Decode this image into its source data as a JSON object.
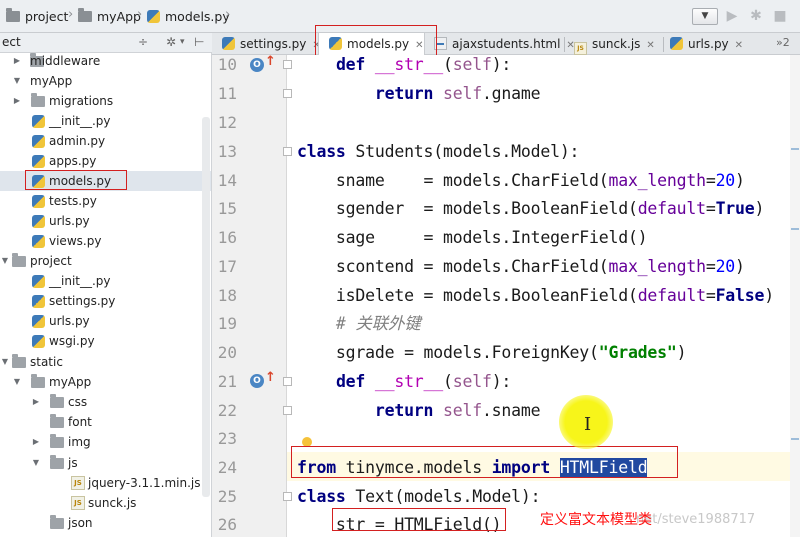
{
  "breadcrumb": [
    "project",
    "myApp",
    "models.py"
  ],
  "project_panel": {
    "title": "ect",
    "tree": [
      {
        "label": "middleware",
        "kind": "folder",
        "expanded": false,
        "selected": false
      },
      {
        "label": "myApp",
        "kind": "folder",
        "expanded": true,
        "selected": false
      },
      {
        "label": "migrations",
        "kind": "folder",
        "expanded": false,
        "selected": false
      },
      {
        "label": "__init__.py",
        "kind": "py",
        "expanded": false,
        "selected": false
      },
      {
        "label": "admin.py",
        "kind": "py",
        "expanded": false,
        "selected": false
      },
      {
        "label": "apps.py",
        "kind": "py",
        "expanded": false,
        "selected": false
      },
      {
        "label": "models.py",
        "kind": "py",
        "expanded": false,
        "selected": true
      },
      {
        "label": "tests.py",
        "kind": "py",
        "expanded": false,
        "selected": false
      },
      {
        "label": "urls.py",
        "kind": "py",
        "expanded": false,
        "selected": false
      },
      {
        "label": "views.py",
        "kind": "py",
        "expanded": false,
        "selected": false
      },
      {
        "label": "project",
        "kind": "folder",
        "expanded": true,
        "selected": false
      },
      {
        "label": "__init__.py",
        "kind": "py",
        "expanded": false,
        "selected": false
      },
      {
        "label": "settings.py",
        "kind": "py",
        "expanded": false,
        "selected": false
      },
      {
        "label": "urls.py",
        "kind": "py",
        "expanded": false,
        "selected": false
      },
      {
        "label": "wsgi.py",
        "kind": "py",
        "expanded": false,
        "selected": false
      },
      {
        "label": "static",
        "kind": "folder",
        "expanded": true,
        "selected": false
      },
      {
        "label": "myApp",
        "kind": "folder",
        "expanded": true,
        "selected": false
      },
      {
        "label": "css",
        "kind": "folder",
        "expanded": false,
        "selected": false
      },
      {
        "label": "font",
        "kind": "folder",
        "expanded": false,
        "selected": false
      },
      {
        "label": "img",
        "kind": "folder",
        "expanded": false,
        "selected": false
      },
      {
        "label": "js",
        "kind": "folder",
        "expanded": true,
        "selected": false
      },
      {
        "label": "jquery-3.1.1.min.js",
        "kind": "js",
        "expanded": false,
        "selected": false
      },
      {
        "label": "sunck.js",
        "kind": "js",
        "expanded": false,
        "selected": false
      },
      {
        "label": "json",
        "kind": "folder",
        "expanded": false,
        "selected": false
      }
    ]
  },
  "tabs": [
    {
      "label": "settings.py",
      "icon": "python-file-icon",
      "active": false
    },
    {
      "label": "models.py",
      "icon": "python-file-icon",
      "active": true
    },
    {
      "label": "ajaxstudents.html",
      "icon": "html-file-icon",
      "active": false
    },
    {
      "label": "sunck.js",
      "icon": "js-file-icon",
      "active": false
    },
    {
      "label": "urls.py",
      "icon": "python-file-icon",
      "active": false
    }
  ],
  "tabs_overflow_count": "2",
  "editor": {
    "lines": [
      {
        "n": "10",
        "text": "    def __str__(self):"
      },
      {
        "n": "11",
        "text": "        return self.gname"
      },
      {
        "n": "12",
        "text": ""
      },
      {
        "n": "13",
        "text": "class Students(models.Model):"
      },
      {
        "n": "14",
        "text": "    sname    = models.CharField(max_length=20)"
      },
      {
        "n": "15",
        "text": "    sgender  = models.BooleanField(default=True)"
      },
      {
        "n": "16",
        "text": "    sage     = models.IntegerField()"
      },
      {
        "n": "17",
        "text": "    scontend = models.CharField(max_length=20)"
      },
      {
        "n": "18",
        "text": "    isDelete = models.BooleanField(default=False)"
      },
      {
        "n": "19",
        "text": "    # 关联外键"
      },
      {
        "n": "20",
        "text": "    sgrade = models.ForeignKey(\"Grades\")"
      },
      {
        "n": "21",
        "text": "    def __str__(self):"
      },
      {
        "n": "22",
        "text": "        return self.sname"
      },
      {
        "n": "23",
        "text": ""
      },
      {
        "n": "24",
        "text": "from tinymce.models import HTMLField"
      },
      {
        "n": "25",
        "text": "class Text(models.Model):"
      },
      {
        "n": "26",
        "text": "    str = HTMLField()"
      }
    ],
    "selected_word": "HTMLField",
    "current_line": "24"
  },
  "annotation": "定义富文本模型类",
  "watermark": "net/steve1988717",
  "colors": {
    "highlight_box": "#d32020",
    "keyword": "#000080",
    "selection": "#2149a0"
  }
}
